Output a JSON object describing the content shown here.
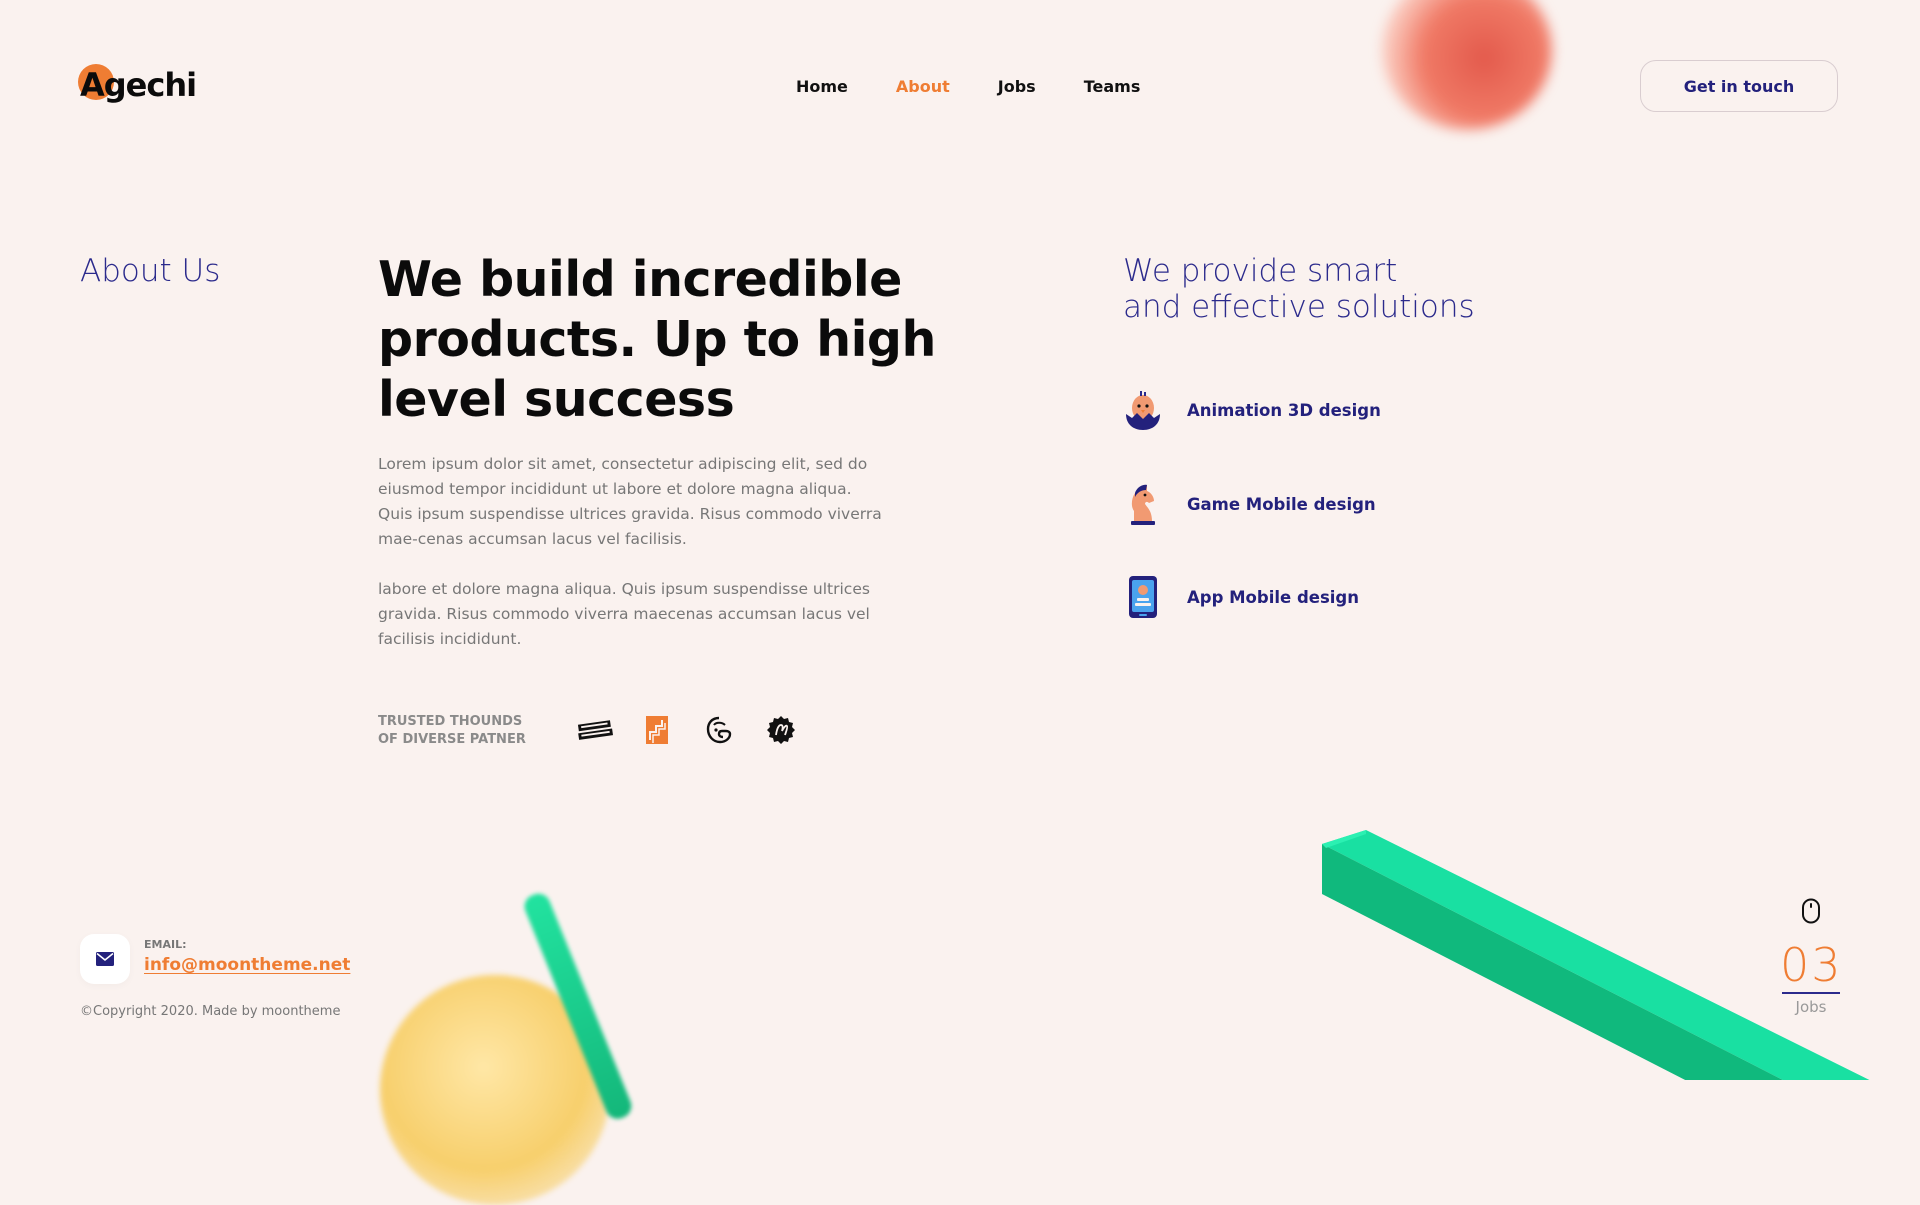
{
  "header": {
    "logo_text": "Agechi",
    "nav": [
      {
        "label": "Home",
        "active": false
      },
      {
        "label": "About",
        "active": true
      },
      {
        "label": "Jobs",
        "active": false
      },
      {
        "label": "Teams",
        "active": false
      }
    ],
    "cta_label": "Get in touch"
  },
  "about": {
    "section_title": "About Us",
    "headline": "We build incredible products. Up to high level success",
    "paragraph1": "Lorem ipsum dolor sit amet, consectetur adipiscing elit, sed do eiusmod tempor incididunt ut labore et dolore magna aliqua. Quis ipsum suspendisse ultrices gravida. Risus commodo viverra mae-cenas accumsan lacus vel facilisis.",
    "paragraph2": "labore et dolore magna aliqua. Quis ipsum suspendisse ultrices gravida. Risus commodo viverra maecenas accumsan lacus vel facilisis incididunt.",
    "trusted_line1": "TRUSTED THOUNDS",
    "trusted_line2": "OF DIVERSE PATNER",
    "partners": [
      "angry-creative-logo",
      "stacked-squares-logo",
      "mailchimp-logo",
      "badge-logo"
    ]
  },
  "services": {
    "title_line1": "We provide smart",
    "title_line2": "and effective solutions",
    "items": [
      {
        "label": "Animation 3D design",
        "icon": "chick-egg-icon"
      },
      {
        "label": "Game Mobile design",
        "icon": "chess-knight-icon"
      },
      {
        "label": "App Mobile design",
        "icon": "smartphone-icon"
      }
    ]
  },
  "footer": {
    "email_label": "EMAIL:",
    "email": "info@moontheme.net",
    "copyright": "©Copyright 2020. Made by moontheme"
  },
  "counter": {
    "value": "03",
    "caption": "Jobs"
  },
  "colors": {
    "background": "#faf2ef",
    "accent": "#ef7d33",
    "navy": "#23217c",
    "green": "#1fd69a"
  }
}
